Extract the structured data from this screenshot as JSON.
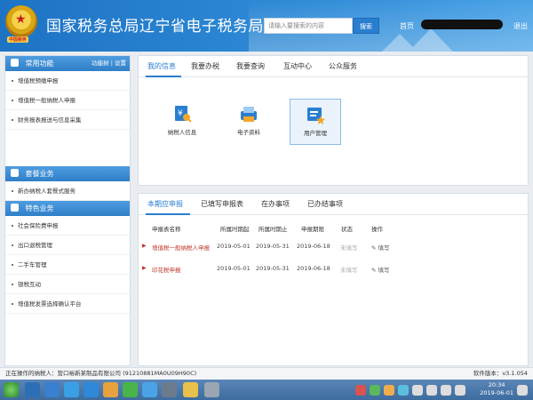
{
  "header": {
    "title": "国家税务总局辽宁省电子税务局",
    "emblem_text": "中国税务",
    "search_placeholder": "请输入要搜索的内容",
    "search_button": "搜索",
    "home_link": "首页",
    "logout": "退出"
  },
  "sidebar": {
    "common": {
      "title": "常用功能",
      "link1": "功能树",
      "sep": "|",
      "link2": "设置",
      "items": [
        "增值税预缴申报",
        "增值税一般纳税人申报",
        "财务报表报送与信息采集"
      ]
    },
    "package": {
      "title": "套餐业务",
      "items": [
        "新办纳税人套餐式服务"
      ]
    },
    "special": {
      "title": "特色业务",
      "items": [
        "社会保险费申报",
        "出口退税管理",
        "二手车管理",
        "银税互动",
        "增值税发票选择确认平台"
      ]
    }
  },
  "top_tabs": [
    "我的信息",
    "我要办税",
    "我要查询",
    "互动中心",
    "公众服务"
  ],
  "apps": [
    {
      "label": "纳税人信息",
      "icon": "taxpayer-info-icon"
    },
    {
      "label": "电子资料",
      "icon": "electronic-docs-icon"
    },
    {
      "label": "用户管理",
      "icon": "user-management-icon"
    }
  ],
  "bottom_tabs": [
    "本期应申报",
    "已填写申报表",
    "在办事项",
    "已办结事项"
  ],
  "table": {
    "headers": [
      "申报表名称",
      "所属时期起",
      "所属时期止",
      "申报期限",
      "状态",
      "操作"
    ],
    "rows": [
      {
        "name": "增值税一般纳税人申报",
        "start": "2019-05-01",
        "end": "2019-05-31",
        "deadline": "2019-06-18",
        "status": "未填写",
        "action": "填写"
      },
      {
        "name": "印花税申报",
        "start": "2019-05-01",
        "end": "2019-05-31",
        "deadline": "2019-06-18",
        "status": "未填写",
        "action": "填写"
      }
    ]
  },
  "status_bar": {
    "operator": "正在操作的纳税人：营口裕新某制品有限公司 (91210881MA0U09H90C)",
    "version": "软件版本：v3.1.054"
  },
  "taskbar": {
    "time": "20:34",
    "date": "2019-06-01"
  },
  "colors": {
    "accent": "#2a7ed0",
    "header": "#1d73c4",
    "danger": "#c0392b"
  }
}
